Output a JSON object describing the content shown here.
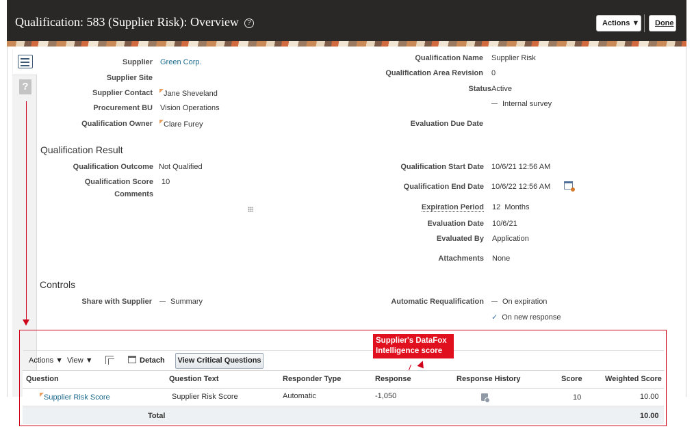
{
  "header": {
    "title": "Qualification: 583 (Supplier Risk): Overview",
    "help_icon": "?",
    "actions_label": "Actions ▼",
    "done_label": "Done"
  },
  "left_fields": [
    {
      "label": "Supplier",
      "value": "Green Corp.",
      "link": true
    },
    {
      "label": "Supplier Site",
      "value": ""
    },
    {
      "label": "Supplier Contact",
      "value": "Jane Sheveland"
    },
    {
      "label": "Procurement BU",
      "value": "Vision Operations"
    },
    {
      "label": "Qualification Owner",
      "value": "Clare Furey"
    }
  ],
  "right_fields": {
    "qualification_name_label": "Qualification Name",
    "qualification_name": "Supplier Risk",
    "area_revision_label": "Qualification Area Revision",
    "area_revision": "0",
    "status_label": "Status",
    "status": "Active",
    "internal_survey": "Internal survey",
    "evaluation_due_label": "Evaluation Due Date"
  },
  "qualification_result": {
    "title": "Qualification Result",
    "outcome_label": "Qualification Outcome",
    "outcome": "Not Qualified",
    "score_label": "Qualification Score",
    "score": "10",
    "comments_label": "Comments",
    "start_label": "Qualification Start Date",
    "start": "10/6/21 12:56 AM",
    "end_label": "Qualification End Date",
    "end": "10/6/22 12:56 AM",
    "expiration_label": "Expiration Period",
    "expiration_value": "12",
    "expiration_unit": "Months",
    "evaluation_date_label": "Evaluation Date",
    "evaluation_date": "10/6/21",
    "evaluated_by_label": "Evaluated By",
    "evaluated_by": "Application",
    "attachments_label": "Attachments",
    "attachments": "None"
  },
  "controls": {
    "title": "Controls",
    "share_label": "Share with Supplier",
    "share_value": "Summary",
    "auto_requal_label": "Automatic Requalification",
    "on_expiration": "On expiration",
    "on_new_response": "On new response"
  },
  "callout": "Supplier's DataFox Intelligence score",
  "toolbar": {
    "actions": "Actions ▼",
    "view": "View ▼",
    "detach": "Detach",
    "view_critical": "View Critical Questions"
  },
  "table": {
    "headers": [
      "Question",
      "Question Text",
      "Responder Type",
      "Response",
      "Response History",
      "Score",
      "Weighted Score"
    ],
    "row": {
      "question": "Supplier Risk Score",
      "question_text": "Supplier Risk Score",
      "responder_type": "Automatic",
      "response": "-1,050",
      "score": "10",
      "weighted_score": "10.00"
    },
    "total_label": "Total",
    "total_value": "10.00"
  }
}
